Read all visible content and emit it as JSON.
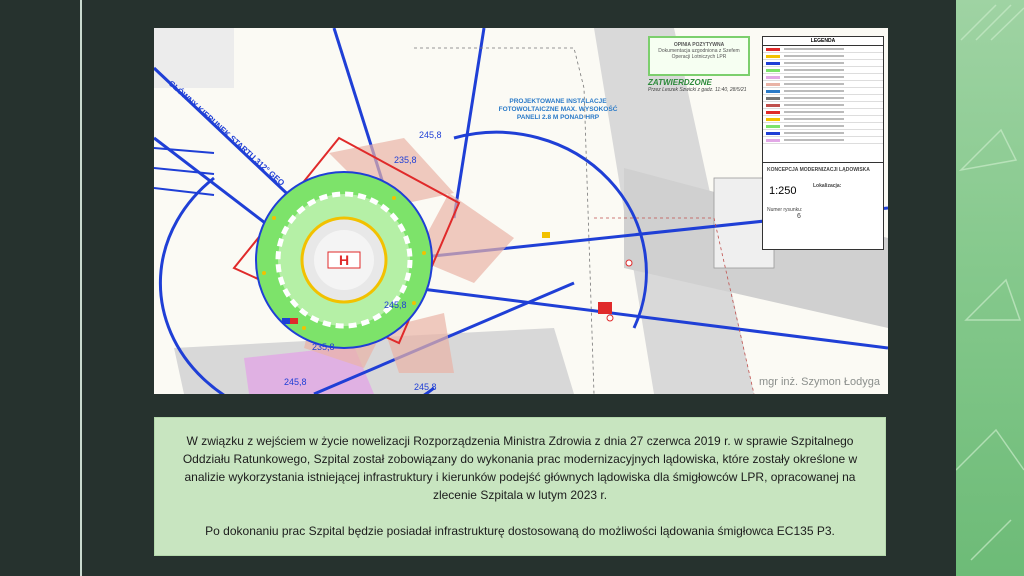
{
  "plan": {
    "approval_title": "OPINIA POZYTYWNA",
    "approval_sub": "Dokumentacja uzgodniona z Szefem Operacji Lotniczych LPR",
    "approved_title": "ZATWIERDZONE",
    "approved_sub": "Przez Leszek Szwicki z gadz. 11:40, 28/5/21",
    "pv_label": "PROJEKTOWANE INSTALACJE FOTOWOLTAICZNE MAX. WYSOKOŚĆ PANELI 2.8 M PONAD HRP",
    "direction_label": "GŁÓWNY KIERUNEK STARTU 312° GEO",
    "height_labels": [
      "245,8",
      "235,8",
      "245,8",
      "235,8",
      "245,8",
      "245,8"
    ],
    "legend_title": "LEGENDA",
    "scale": "1:250",
    "block_title": "KONCEPCJA MODERNIZACJI LĄDOWISKA",
    "block_location": "Lokalizacja:",
    "block_sheet": "Numer rysunku:",
    "block_sheet_no": "6",
    "credit": "mgr inż. Szymon Łodyga"
  },
  "note": {
    "paragraph1": "W związku z wejściem w życie nowelizacji Rozporządzenia Ministra Zdrowia z dnia 27 czerwca 2019 r. w sprawie Szpitalnego Oddziału Ratunkowego, Szpital został zobowiązany do wykonania prac modernizacyjnych lądowiska, które zostały określone w analizie wykorzystania istniejącej infrastruktury i kierunków podejść głównych lądowiska dla śmigłowców LPR, opracowanej na zlecenie Szpitala w lutym 2023 r.",
    "paragraph2": "Po dokonaniu prac Szpital będzie posiadał infrastrukturę dostosowaną do możliwości lądowania śmigłowca EC135 P3."
  },
  "colors": {
    "accent": "#7ccf6d",
    "note_bg": "#c8e5c0",
    "slide_bg": "#26322e",
    "route_blue": "#1f3fd6",
    "pad_green": "#7de36a"
  }
}
